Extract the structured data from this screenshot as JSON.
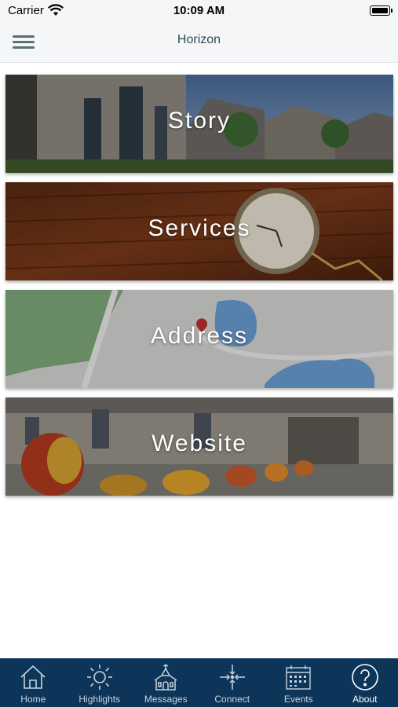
{
  "status_bar": {
    "carrier": "Carrier",
    "time": "10:09 AM"
  },
  "nav": {
    "title": "Horizon",
    "menu_icon": "hamburger-menu-icon"
  },
  "tiles": [
    {
      "label": "Story",
      "background": "church-building-photo"
    },
    {
      "label": "Services",
      "background": "pocket-watch-photo"
    },
    {
      "label": "Address",
      "background": "map-photo"
    },
    {
      "label": "Website",
      "background": "tulips-building-photo"
    }
  ],
  "tab_bar": {
    "background": "#0d3559",
    "items": [
      {
        "label": "Home",
        "icon": "home-icon"
      },
      {
        "label": "Highlights",
        "icon": "sun-icon"
      },
      {
        "label": "Messages",
        "icon": "church-icon"
      },
      {
        "label": "Connect",
        "icon": "connect-arrows-icon"
      },
      {
        "label": "Events",
        "icon": "calendar-icon"
      },
      {
        "label": "About",
        "icon": "question-circle-icon",
        "active": true
      }
    ]
  }
}
